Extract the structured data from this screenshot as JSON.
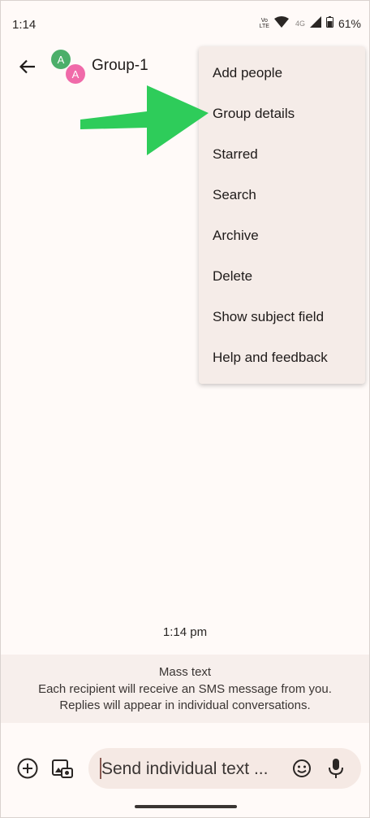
{
  "status_bar": {
    "time": "1:14",
    "volte_top": "Vo",
    "volte_bottom": "LTE",
    "network": "4G",
    "battery": "61%"
  },
  "header": {
    "title": "Group-1",
    "avatars": [
      "A",
      "A"
    ]
  },
  "menu": {
    "items": [
      "Add people",
      "Group details",
      "Starred",
      "Search",
      "Archive",
      "Delete",
      "Show subject field",
      "Help and feedback"
    ]
  },
  "conversation": {
    "timestamp": "1:14 pm",
    "info_title": "Mass text",
    "info_line1": "Each recipient will receive an SMS message from you.",
    "info_line2": "Replies will appear in individual conversations."
  },
  "composer": {
    "placeholder": "Send individual text ..."
  },
  "colors": {
    "background": "#fffaf8",
    "menu_bg": "#f5ece8",
    "arrow": "#2ecc5a",
    "avatar1": "#4caf6a",
    "avatar2": "#f06aa9"
  }
}
